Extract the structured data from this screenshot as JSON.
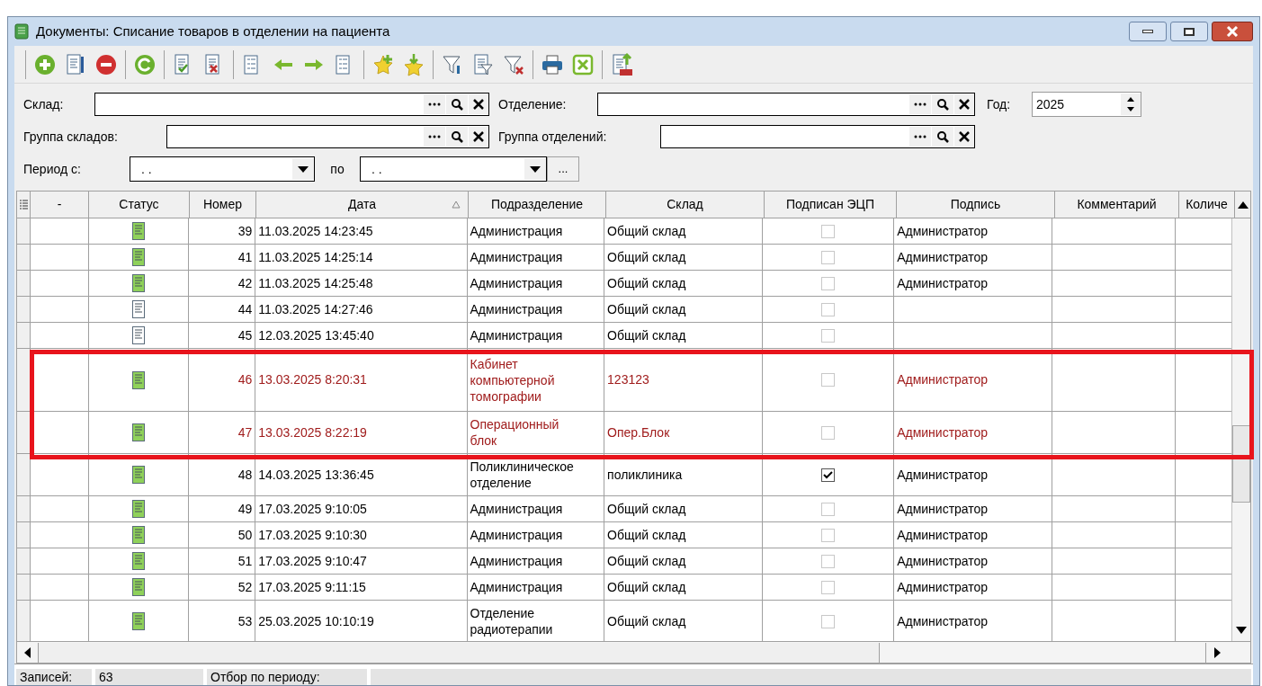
{
  "window": {
    "title": "Документы: Списание товаров в отделении на пациента"
  },
  "filters": {
    "warehouse": {
      "label": "Склад:"
    },
    "department": {
      "label": "Отделение:"
    },
    "year": {
      "label": "Год:",
      "value": "2025"
    },
    "warehouse_group": {
      "label": "Группа складов:"
    },
    "department_group": {
      "label": "Группа отделений:"
    },
    "period_from": {
      "label": "Период с:",
      "value": ". ."
    },
    "period_to": {
      "label": "по",
      "value": ". ."
    },
    "period_button": "..."
  },
  "table": {
    "columns": [
      {
        "label": "-",
        "sorted": false
      },
      {
        "label": "Статус",
        "sorted": false
      },
      {
        "label": "Номер",
        "sorted": false
      },
      {
        "label": "Дата",
        "sorted": true
      },
      {
        "label": "Подразделение",
        "sorted": false
      },
      {
        "label": "Склад",
        "sorted": false
      },
      {
        "label": "Подписан ЭЦП",
        "sorted": false
      },
      {
        "label": "Подпись",
        "sorted": false
      },
      {
        "label": "Комментарий",
        "sorted": false
      },
      {
        "label": "Количе",
        "sorted": false
      }
    ],
    "rows": [
      {
        "completed": true,
        "number": "39",
        "date": "11.03.2025 14:23:45",
        "subdivision": "Администрация",
        "warehouse": "Общий склад",
        "signed": false,
        "signature": "Администратор",
        "marked": false
      },
      {
        "completed": true,
        "number": "41",
        "date": "11.03.2025 14:25:14",
        "subdivision": "Администрация",
        "warehouse": "Общий склад",
        "signed": false,
        "signature": "Администратор",
        "marked": false
      },
      {
        "completed": true,
        "number": "42",
        "date": "11.03.2025 14:25:48",
        "subdivision": "Администрация",
        "warehouse": "Общий склад",
        "signed": false,
        "signature": "Администратор",
        "marked": false
      },
      {
        "completed": false,
        "number": "44",
        "date": "11.03.2025 14:27:46",
        "subdivision": "Администрация",
        "warehouse": "Общий склад",
        "signed": false,
        "marked": false
      },
      {
        "completed": false,
        "number": "45",
        "date": "12.03.2025 13:45:40",
        "subdivision": "Администрация",
        "warehouse": "Общий склад",
        "signed": false,
        "marked": false
      },
      {
        "completed": true,
        "number": "46",
        "date": "13.03.2025 8:20:31",
        "subdivision": "Кабинет компьютерной томографии",
        "warehouse": "123123",
        "signed": false,
        "signature": "Администратор",
        "marked": true
      },
      {
        "completed": true,
        "number": "47",
        "date": "13.03.2025 8:22:19",
        "subdivision": "Операционный блок",
        "warehouse": "Опер.Блок",
        "signed": false,
        "signature": "Администратор",
        "marked": true
      },
      {
        "completed": true,
        "number": "48",
        "date": "14.03.2025 13:36:45",
        "subdivision": "Поликлиническое отделение",
        "warehouse": "поликлиника",
        "signed": true,
        "signature": "Администратор",
        "marked": false
      },
      {
        "completed": true,
        "number": "49",
        "date": "17.03.2025 9:10:05",
        "subdivision": "Администрация",
        "warehouse": "Общий склад",
        "signed": false,
        "signature": "Администратор",
        "marked": false
      },
      {
        "completed": true,
        "number": "50",
        "date": "17.03.2025 9:10:30",
        "subdivision": "Администрация",
        "warehouse": "Общий склад",
        "signed": false,
        "signature": "Администратор",
        "marked": false
      },
      {
        "completed": true,
        "number": "51",
        "date": "17.03.2025 9:10:47",
        "subdivision": "Администрация",
        "warehouse": "Общий склад",
        "signed": false,
        "signature": "Администратор",
        "marked": false
      },
      {
        "completed": true,
        "number": "52",
        "date": "17.03.2025 9:11:15",
        "subdivision": "Администрация",
        "warehouse": "Общий склад",
        "signed": false,
        "signature": "Администратор",
        "marked": false
      },
      {
        "completed": true,
        "number": "53",
        "date": "25.03.2025 10:10:19",
        "subdivision": "Отделение радиотерапии",
        "warehouse": "Общий склад",
        "signed": false,
        "signature": "Администратор",
        "marked": false
      }
    ]
  },
  "status_bar": {
    "records_label": "Записей:",
    "records_value": "63",
    "period_label": "Отбор по периоду:"
  }
}
